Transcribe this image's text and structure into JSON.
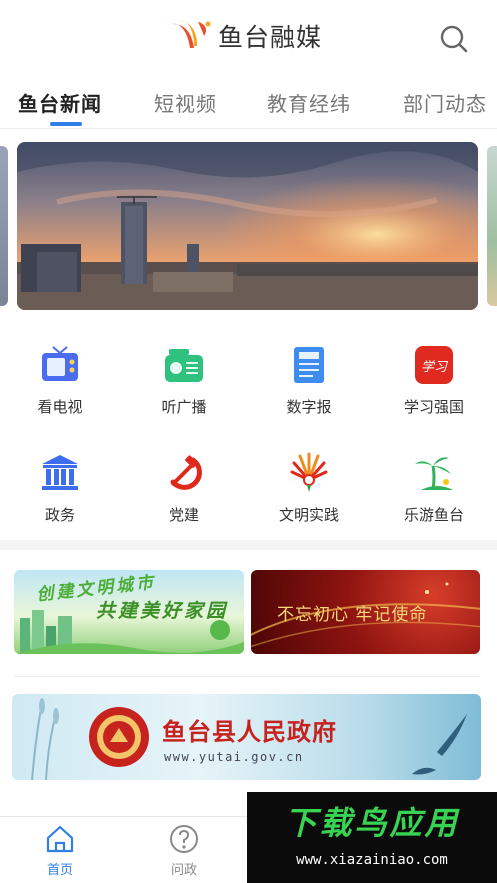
{
  "header": {
    "app_name": "鱼台融媒",
    "search_icon": "search-icon"
  },
  "tabs": [
    {
      "label": "鱼台新闻",
      "active": true
    },
    {
      "label": "短视频",
      "active": false
    },
    {
      "label": "教育经纬",
      "active": false
    },
    {
      "label": "部门动态",
      "active": false
    }
  ],
  "grid": [
    {
      "label": "看电视",
      "icon": "tv-icon"
    },
    {
      "label": "听广播",
      "icon": "radio-icon"
    },
    {
      "label": "数字报",
      "icon": "newspaper-icon"
    },
    {
      "label": "学习强国",
      "icon": "xuexi-icon",
      "icon_text": "学习"
    },
    {
      "label": "政务",
      "icon": "government-building-icon"
    },
    {
      "label": "党建",
      "icon": "hammer-sickle-icon"
    },
    {
      "label": "文明实践",
      "icon": "civilization-fan-icon"
    },
    {
      "label": "乐游鱼台",
      "icon": "palm-tree-icon"
    }
  ],
  "promos": {
    "left_line1": "创建文明城市",
    "left_line2": "共建美好家园",
    "right_text": "不忘初心 牢记使命"
  },
  "gov_banner": {
    "title": "鱼台县人民政府",
    "url": "www.yutai.gov.cn"
  },
  "bottom_nav": [
    {
      "label": "首页",
      "icon": "home-icon",
      "active": true
    },
    {
      "label": "问政",
      "icon": "question-icon",
      "active": false
    }
  ],
  "watermark": {
    "title": "下载鸟应用",
    "url": "www.xiazainiao.com"
  },
  "colors": {
    "accent": "#2f7fe6",
    "gov_red": "#c6231f"
  }
}
